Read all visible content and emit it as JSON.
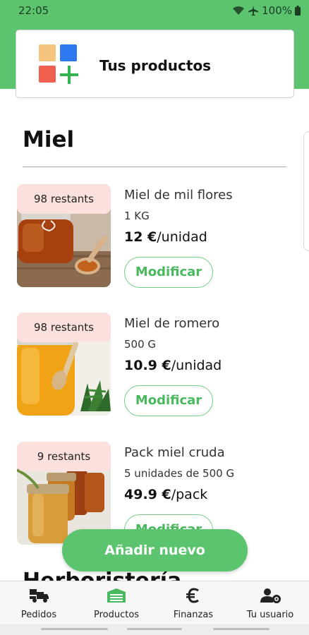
{
  "status_bar": {
    "time": "22:05",
    "battery": "100%"
  },
  "header": {
    "title": "Tus productos"
  },
  "section": {
    "title": "Miel"
  },
  "products": [
    {
      "stock": "98 restants",
      "name": "Miel de mil flores",
      "quantity": "1 KG",
      "price": "12 €",
      "unit": "/unidad",
      "button": "Modificar"
    },
    {
      "stock": "98 restants",
      "name": "Miel de romero",
      "quantity": "500 G",
      "price": "10.9 €",
      "unit": "/unidad",
      "button": "Modificar"
    },
    {
      "stock": "9 restants",
      "name": "Pack miel cruda",
      "quantity": "5 unidades de 500 G",
      "price": "49.9 €",
      "unit": "/pack",
      "button": "Modificar"
    }
  ],
  "next_section": {
    "title": "Herboristería"
  },
  "add_button": {
    "label": "Añadir nuevo"
  },
  "bottom_nav": [
    {
      "label": "Pedidos",
      "icon": "delivery-truck-icon"
    },
    {
      "label": "Productos",
      "icon": "store-icon"
    },
    {
      "label": "Finanzas",
      "icon": "euro-icon"
    },
    {
      "label": "Tu usuario",
      "icon": "user-settings-icon"
    }
  ],
  "colors": {
    "brand_green": "#5cc46f",
    "badge_pink": "#fbe0dd",
    "button_text_green": "#4ab95e"
  }
}
